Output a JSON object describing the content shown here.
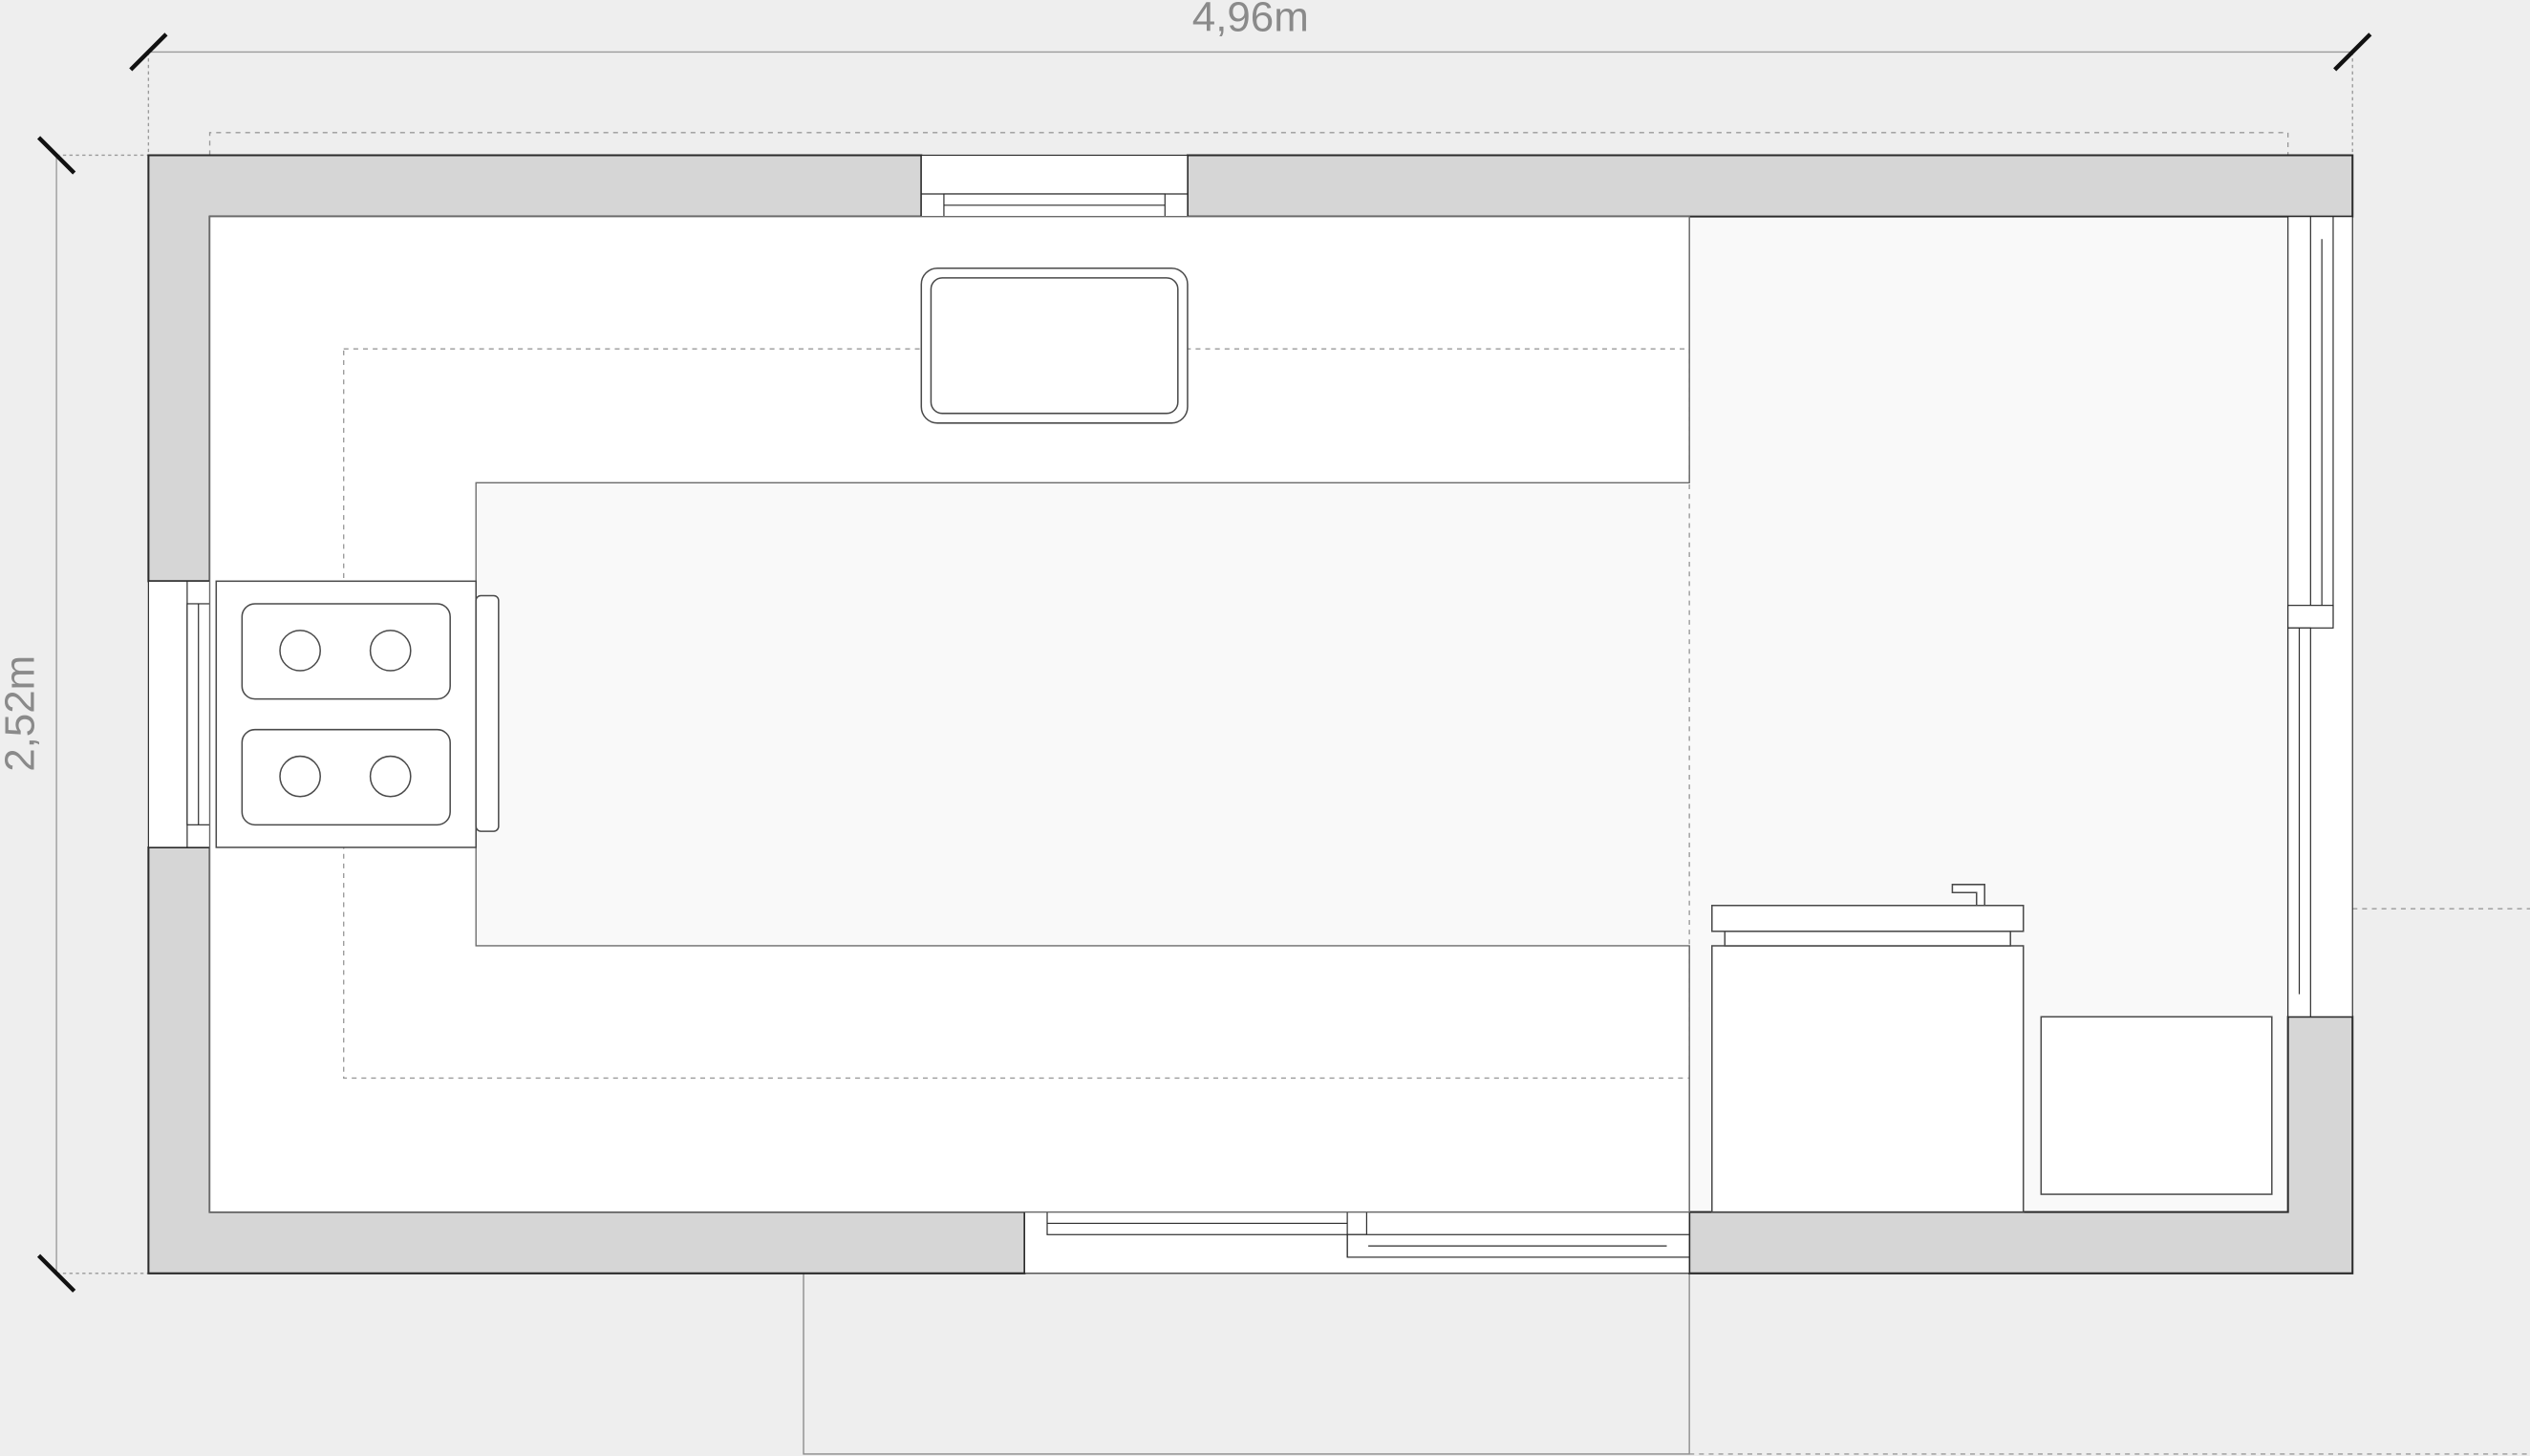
{
  "dimensions": {
    "width_label": "4,96m",
    "height_label": "2,52m"
  },
  "colors": {
    "background": "#eeeeee",
    "wall_fill": "#d6d6d6",
    "floor_fill": "#f9f9f9",
    "counter_fill": "#ffffff",
    "line": "#2b2b2b",
    "thin_line": "#7a7a7a",
    "dim_text": "#8a8a8a",
    "tick": "#111111"
  }
}
